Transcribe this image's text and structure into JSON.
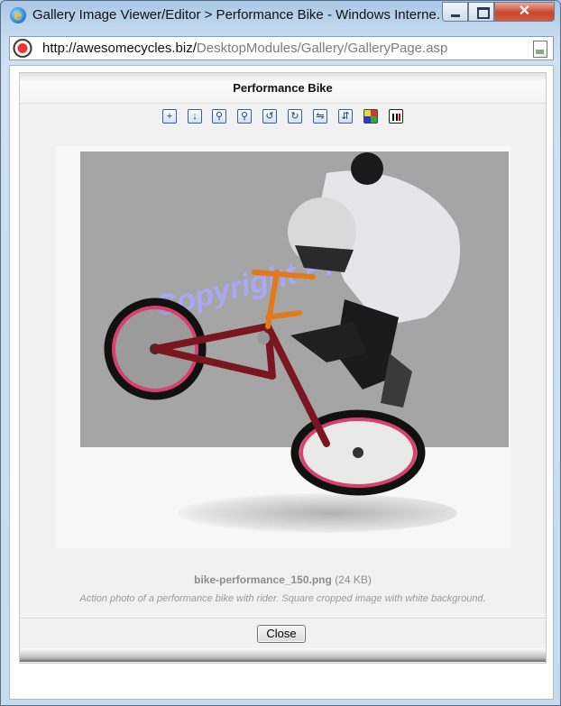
{
  "window": {
    "title": "Gallery Image Viewer/Editor > Performance Bike - Windows Interne...",
    "close_glyph": "✕"
  },
  "address": {
    "host": "http://awesomecycles.biz/",
    "path": "DesktopModules/Gallery/GalleryPage.asp"
  },
  "viewer": {
    "title": "Performance Bike",
    "toolbar": [
      {
        "name": "add-image-icon",
        "glyph": "+"
      },
      {
        "name": "save-image-icon",
        "glyph": "↓"
      },
      {
        "name": "zoom-in-icon",
        "glyph": "⚲"
      },
      {
        "name": "zoom-out-icon",
        "glyph": "⚲"
      },
      {
        "name": "rotate-left-icon",
        "glyph": "↺"
      },
      {
        "name": "rotate-right-icon",
        "glyph": "↻"
      },
      {
        "name": "flip-horizontal-icon",
        "glyph": "⇋"
      },
      {
        "name": "flip-vertical-icon",
        "glyph": "⇵"
      },
      {
        "name": "color-grid-icon",
        "glyph": ""
      },
      {
        "name": "histogram-icon",
        "glyph": ""
      }
    ],
    "watermark_text": "Copyright Protected",
    "file_name": "bike-performance_150.png",
    "file_size": "(24 KB)",
    "description": "Action photo of a performance bike with rider. Square cropped image with white background.",
    "close_label": "Close"
  },
  "colors": {
    "watermark": "#a9a9ff",
    "frame_red": "#7a1620",
    "tire_pink": "#d84070",
    "handlebar_orange": "#e07a1a"
  }
}
